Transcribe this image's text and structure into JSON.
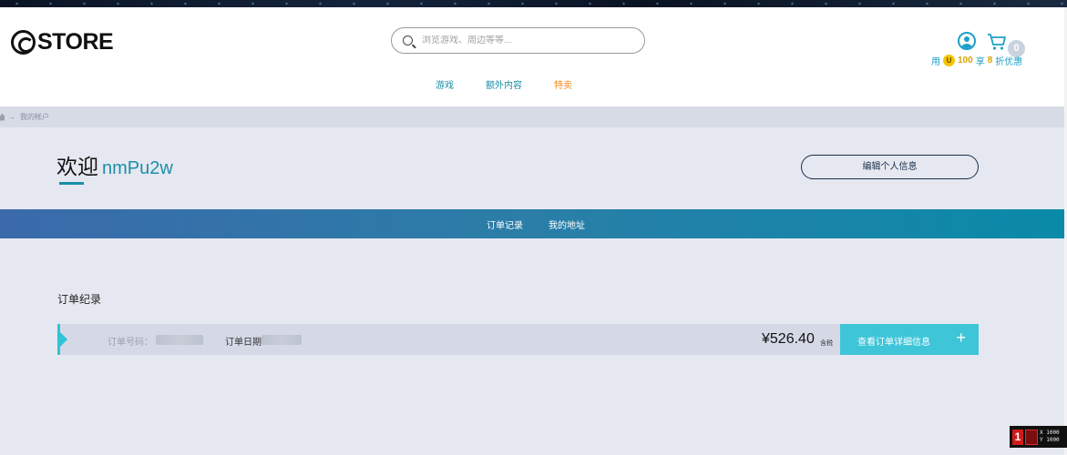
{
  "header": {
    "logo_text": "STORE",
    "search": {
      "placeholder": "浏览游戏、周边等等..."
    },
    "nav": [
      {
        "label": "游戏"
      },
      {
        "label": "额外内容"
      },
      {
        "label": "特卖"
      }
    ],
    "cart_count": "0",
    "promo": {
      "prefix": "用",
      "coin_letter": "U",
      "amount": "100",
      "mid": "享",
      "discount": "8",
      "suffix": "折优惠"
    }
  },
  "breadcrumb": {
    "current": "我的帐户"
  },
  "account": {
    "welcome": "欢迎",
    "username": "nmPu2w",
    "edit_label": "编辑个人信息"
  },
  "tabs": [
    {
      "label": "订单记录"
    },
    {
      "label": "我的地址"
    }
  ],
  "orders": {
    "section_title": "订单纪录",
    "order_no_label": "订单号码：",
    "order_date_label": "订单日期",
    "price": "¥526.40",
    "tax_note": "含税",
    "detail_label": "查看订单详细信息",
    "detail_icon": "+"
  },
  "overlay": {
    "badge": "1",
    "line1": "X 1000",
    "line2": "Y 1000"
  },
  "colors": {
    "accent": "#1a8fa8",
    "sale": "#f08a1e",
    "cyan_button": "#3ec5d8",
    "background": "#e6e8f1"
  }
}
